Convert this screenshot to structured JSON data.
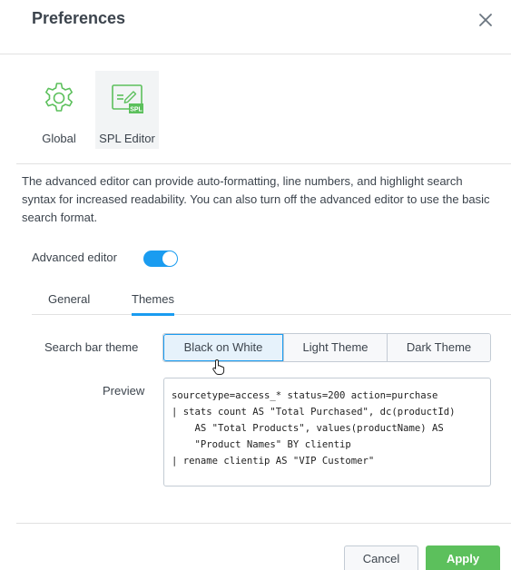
{
  "dialog": {
    "title": "Preferences"
  },
  "icon_tabs": [
    {
      "label": "Global",
      "icon": "gear-icon"
    },
    {
      "label": "SPL Editor",
      "icon": "spl-editor-icon",
      "icon_text": "SPL",
      "selected": true
    }
  ],
  "description": "The advanced editor can provide auto-formatting, line numbers, and highlight search syntax for increased readability. You can also turn off the advanced editor to use the basic search format.",
  "advanced_editor": {
    "label": "Advanced editor",
    "enabled": true
  },
  "sub_tabs": [
    {
      "label": "General"
    },
    {
      "label": "Themes",
      "selected": true
    }
  ],
  "theme": {
    "label": "Search bar theme",
    "options": [
      "Black on White",
      "Light Theme",
      "Dark Theme"
    ],
    "selected": "Black on White"
  },
  "preview": {
    "label": "Preview",
    "code": "sourcetype=access_* status=200 action=purchase\n| stats count AS \"Total Purchased\", dc(productId)\n    AS \"Total Products\", values(productName) AS\n    \"Product Names\" BY clientip\n| rename clientip AS \"VIP Customer\""
  },
  "footer": {
    "cancel_label": "Cancel",
    "apply_label": "Apply"
  },
  "colors": {
    "accent": "#1a9cf0",
    "apply": "#5cc05c",
    "icon_green": "#5cc05c"
  }
}
